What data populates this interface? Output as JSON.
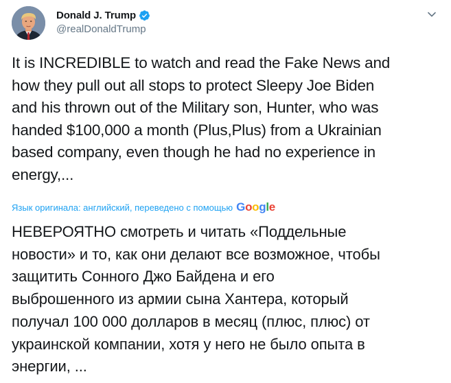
{
  "author": {
    "display_name": "Donald J. Trump",
    "handle": "@realDonaldTrump",
    "verified": true,
    "avatar_icon": "profile-photo",
    "verified_icon": "verified-badge-icon"
  },
  "menu": {
    "icon": "chevron-down-icon"
  },
  "tweet": {
    "text": "It is INCREDIBLE to watch and read the Fake News and\nhow they pull out all stops to protect Sleepy Joe Biden\nand his thrown out of the Military son, Hunter, who was\nhanded $100,000 a month (Plus,Plus) from a Ukrainian\nbased company, even though he had no experience in\nenergy,..."
  },
  "translation": {
    "note": "Язык оригинала: английский, переведено с помощью",
    "provider": "Google",
    "text": "НЕВЕРОЯТНО смотреть и читать «Поддельные\nновости» и то, как они делают все возможное, чтобы\nзащитить Сонного Джо Байдена и его\nвыброшенного из армии сына Хантера, который\nполучал 100 000 долларов в месяц (плюс, плюс) от\nукраинской компании, хотя у него не было опыта в\nэнергии, ..."
  },
  "colors": {
    "link": "#1da1f2",
    "text": "#14171a",
    "secondary": "#657786",
    "google_blue": "#4285f4",
    "google_red": "#ea4335",
    "google_yellow": "#fbbc05",
    "google_green": "#34a853"
  }
}
